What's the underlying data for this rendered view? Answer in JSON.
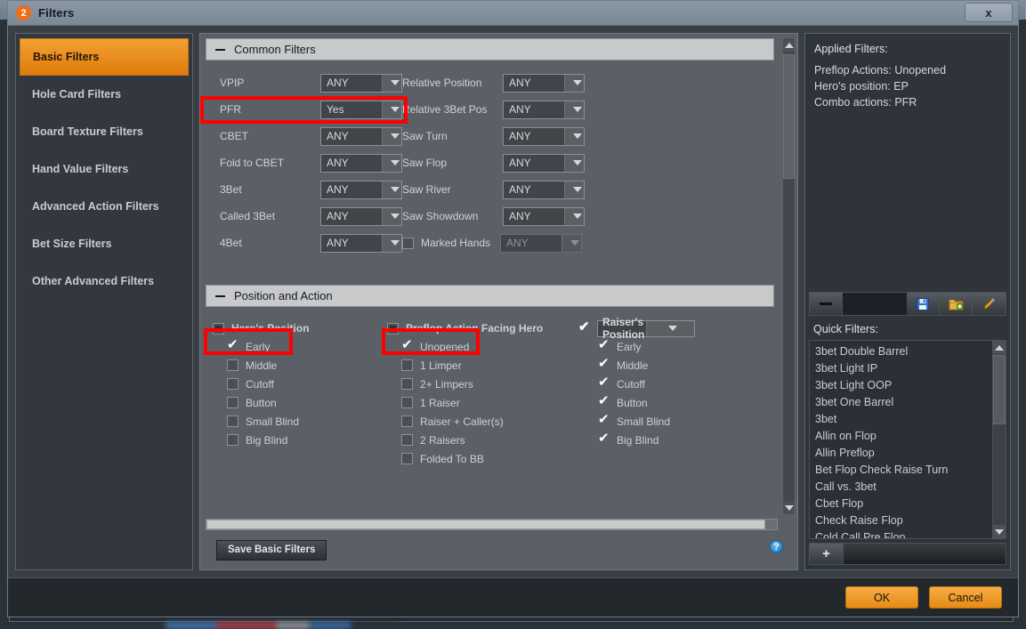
{
  "window": {
    "title": "Filters",
    "badge": "2",
    "close_label": "x",
    "close_icon": "close-icon"
  },
  "sidebar": {
    "items": [
      {
        "label": "Basic Filters",
        "active": true
      },
      {
        "label": "Hole Card Filters",
        "active": false
      },
      {
        "label": "Board Texture Filters",
        "active": false
      },
      {
        "label": "Hand Value Filters",
        "active": false
      },
      {
        "label": "Advanced Action Filters",
        "active": false
      },
      {
        "label": "Bet Size Filters",
        "active": false
      },
      {
        "label": "Other Advanced Filters",
        "active": false
      }
    ]
  },
  "common_filters": {
    "header": "Common Filters",
    "collapse_icon": "minus-icon",
    "left_column": [
      {
        "label": "VPIP",
        "value": "ANY"
      },
      {
        "label": "PFR",
        "value": "Yes",
        "highlighted": true
      },
      {
        "label": "CBET",
        "value": "ANY"
      },
      {
        "label": "Fold to CBET",
        "value": "ANY"
      },
      {
        "label": "3Bet",
        "value": "ANY"
      },
      {
        "label": "Called 3Bet",
        "value": "ANY"
      },
      {
        "label": "4Bet",
        "value": "ANY"
      }
    ],
    "right_column": [
      {
        "label": "Relative Position",
        "value": "ANY",
        "checkbox": false
      },
      {
        "label": "Relative 3Bet Pos",
        "value": "ANY",
        "checkbox": false
      },
      {
        "label": "Saw Turn",
        "value": "ANY",
        "checkbox": false
      },
      {
        "label": "Saw Flop",
        "value": "ANY",
        "checkbox": false
      },
      {
        "label": "Saw River",
        "value": "ANY",
        "checkbox": false
      },
      {
        "label": "Saw Showdown",
        "value": "ANY",
        "checkbox": false
      },
      {
        "label": "Marked Hands",
        "value": "ANY",
        "checkbox": true,
        "checked": false,
        "disabled": true
      }
    ]
  },
  "position_and_action": {
    "header": "Position and Action",
    "collapse_icon": "minus-icon",
    "heros_position": {
      "group_label": "Hero's Position",
      "group_state": "indeterminate",
      "options": [
        {
          "label": "Early",
          "checked": true,
          "highlighted": true
        },
        {
          "label": "Middle",
          "checked": false
        },
        {
          "label": "Cutoff",
          "checked": false
        },
        {
          "label": "Button",
          "checked": false
        },
        {
          "label": "Small Blind",
          "checked": false
        },
        {
          "label": "Big Blind",
          "checked": false
        }
      ]
    },
    "preflop_action": {
      "group_label": "Preflop Action Facing Hero",
      "group_state": "indeterminate",
      "options": [
        {
          "label": "Unopened",
          "checked": true,
          "highlighted": true
        },
        {
          "label": "1 Limper",
          "checked": false
        },
        {
          "label": "2+ Limpers",
          "checked": false
        },
        {
          "label": "1 Raiser",
          "checked": false
        },
        {
          "label": "Raiser + Caller(s)",
          "checked": false
        },
        {
          "label": "2 Raisers",
          "checked": false
        },
        {
          "label": "Folded To BB",
          "checked": false
        }
      ]
    },
    "raisers_position": {
      "group_label": "Raiser's Position",
      "group_state": "checked",
      "dropdown_icon": "chevron-down-icon",
      "options": [
        {
          "label": "Early",
          "checked": true
        },
        {
          "label": "Middle",
          "checked": true
        },
        {
          "label": "Cutoff",
          "checked": true
        },
        {
          "label": "Button",
          "checked": true
        },
        {
          "label": "Small Blind",
          "checked": true
        },
        {
          "label": "Big Blind",
          "checked": true
        }
      ]
    }
  },
  "center_footer": {
    "save_label": "Save Basic Filters",
    "help_label": "?",
    "help_icon": "help-icon"
  },
  "applied_filters": {
    "title": "Applied Filters:",
    "lines": [
      "Preflop Actions: Unopened",
      "Hero's position: EP",
      "Combo actions: PFR"
    ]
  },
  "quick_filters": {
    "title": "Quick Filters:",
    "toolbar": [
      {
        "name": "minus-icon",
        "glyph": ""
      },
      {
        "name": "save-icon",
        "glyph": ""
      },
      {
        "name": "new-folder-icon",
        "glyph": ""
      },
      {
        "name": "edit-pencil-icon",
        "glyph": ""
      }
    ],
    "add_label": "+",
    "items": [
      "3bet Double Barrel",
      "3bet Light IP",
      "3bet Light OOP",
      "3bet One Barrel",
      "3bet",
      "Allin on Flop",
      "Allin Preflop",
      "Bet Flop Check Raise Turn",
      "Call vs. 3bet",
      "Cbet Flop",
      "Check Raise Flop",
      "Cold Call Pre Flop"
    ]
  },
  "footer": {
    "ok_label": "OK",
    "cancel_label": "Cancel"
  },
  "colors": {
    "accent": "#e88a14",
    "highlight_box": "#fe0000",
    "panel_bg": "#5b6066",
    "dialog_bg": "#3a3f45"
  }
}
